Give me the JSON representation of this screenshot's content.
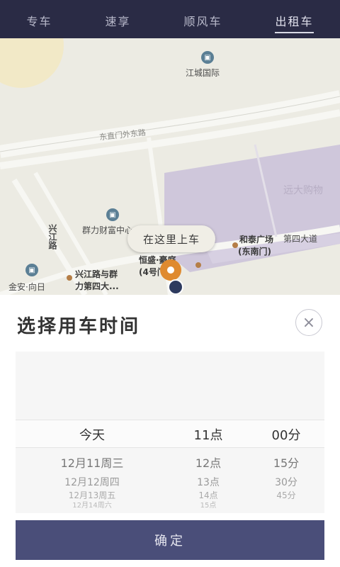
{
  "nav": {
    "tabs": [
      {
        "label": "专车",
        "active": false
      },
      {
        "label": "速享",
        "active": false
      },
      {
        "label": "顺风车",
        "active": false
      },
      {
        "label": "出租车",
        "active": true
      }
    ]
  },
  "map": {
    "pickup_bubble": "在这里上车",
    "labels": {
      "jiangcheng": "江城国际",
      "qunli": "群力财富中心",
      "xingjiang_road": "兴江路",
      "hengsheng": "恒盛·豪庭",
      "hengsheng_gate": "(4号门)",
      "hetai": "和泰广场",
      "hetai_gate": "(东南门)",
      "fourth_ave": "第四大道",
      "street_top": "东直门外东路",
      "corner_left_1": "金安·向日",
      "xingjiang_junction": "兴江路与群",
      "xingjiang_junction_2": "力第四大...",
      "mall": "远大购物"
    }
  },
  "sheet": {
    "title": "选择用车时间",
    "close_symbol": "×",
    "picker": {
      "day": {
        "selected": "今天",
        "options": [
          "12月11周三",
          "12月12周四",
          "12月13周五",
          "12月14周六"
        ]
      },
      "hour": {
        "selected": "11点",
        "options": [
          "12点",
          "13点",
          "14点",
          "15点"
        ]
      },
      "minute": {
        "selected": "00分",
        "options": [
          "15分",
          "30分",
          "45分"
        ]
      }
    },
    "confirm_label": "确定"
  },
  "colors": {
    "nav_bg": "#2a2b45",
    "confirm_bg": "#4a4e79",
    "pin": "#df8a2f"
  }
}
